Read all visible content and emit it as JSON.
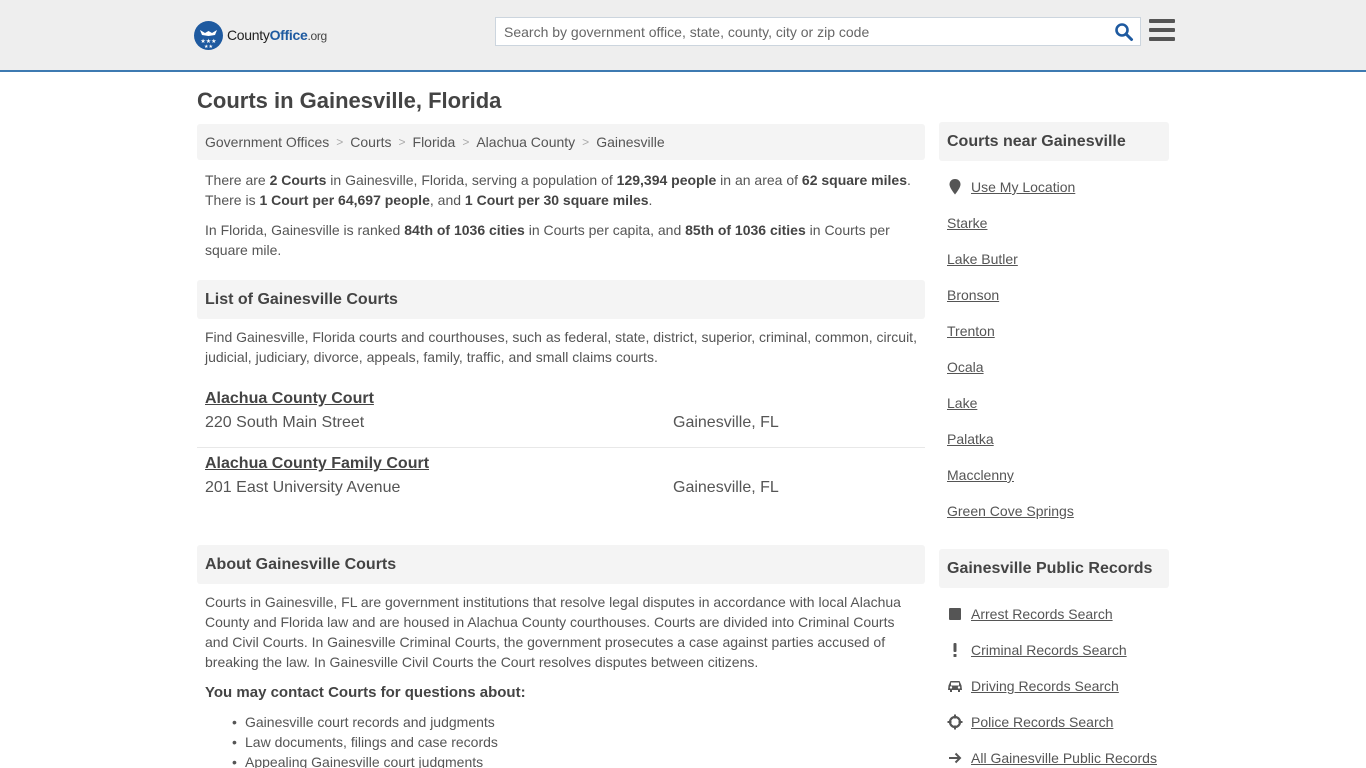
{
  "header": {
    "logo": {
      "name_main": "County",
      "name_bold": "Office",
      "name_suffix": ".org"
    },
    "search": {
      "placeholder": "Search by government office, state, county, city or zip code",
      "value": ""
    },
    "colors": {
      "accent": "#1e5aa0",
      "header_border": "#3e7ab1",
      "header_bg": "#eeeeee"
    }
  },
  "page": {
    "title": "Courts in Gainesville, Florida"
  },
  "breadcrumb": [
    "Government Offices",
    "Courts",
    "Florida",
    "Alachua County",
    "Gainesville"
  ],
  "summary": {
    "p1": {
      "t1": "There are ",
      "b1": "2 Courts",
      "t2": " in Gainesville, Florida, serving a population of ",
      "b2": "129,394 people",
      "t3": " in an area of ",
      "b3": "62 square miles",
      "t4": ". There is ",
      "b4": "1 Court per 64,697 people",
      "t5": ", and ",
      "b5": "1 Court per 30 square miles",
      "t6": "."
    },
    "p2": {
      "t1": "In Florida, Gainesville is ranked ",
      "b1": "84th of 1036 cities",
      "t2": " in Courts per capita, and ",
      "b2": "85th of 1036 cities",
      "t3": " in Courts per square mile."
    }
  },
  "list_section": {
    "heading": "List of Gainesville Courts",
    "intro": "Find Gainesville, Florida courts and courthouses, such as federal, state, district, superior, criminal, common, circuit, judicial, judiciary, divorce, appeals, family, traffic, and small claims courts.",
    "courts": [
      {
        "name": "Alachua County Court",
        "address": "220 South Main Street",
        "city": "Gainesville, FL"
      },
      {
        "name": "Alachua County Family Court",
        "address": "201 East University Avenue",
        "city": "Gainesville, FL"
      }
    ]
  },
  "about_section": {
    "heading": "About Gainesville Courts",
    "body": "Courts in Gainesville, FL are government institutions that resolve legal disputes in accordance with local Alachua County and Florida law and are housed in Alachua County courthouses. Courts are divided into Criminal Courts and Civil Courts. In Gainesville Criminal Courts, the government prosecutes a case against parties accused of breaking the law. In Gainesville Civil Courts the Court resolves disputes between citizens.",
    "contact_heading": "You may contact Courts for questions about:",
    "topics": [
      "Gainesville court records and judgments",
      "Law documents, filings and case records",
      "Appealing Gainesville court judgments"
    ]
  },
  "sidebar": {
    "nearby": {
      "heading": "Courts near Gainesville",
      "use_location": {
        "label": "Use My Location",
        "icon": "map-marker-icon"
      },
      "cities": [
        "Starke",
        "Lake Butler",
        "Bronson",
        "Trenton",
        "Ocala",
        "Lake",
        "Palatka",
        "Macclenny",
        "Green Cove Springs"
      ]
    },
    "records": {
      "heading": "Gainesville Public Records",
      "links": [
        {
          "label": "Arrest Records Search",
          "icon": "square-icon"
        },
        {
          "label": "Criminal Records Search",
          "icon": "exclamation-icon"
        },
        {
          "label": "Driving Records Search",
          "icon": "car-icon"
        },
        {
          "label": "Police Records Search",
          "icon": "crosshairs-icon"
        },
        {
          "label": "All Gainesville Public Records",
          "icon": "arrow-right-icon"
        }
      ]
    }
  }
}
